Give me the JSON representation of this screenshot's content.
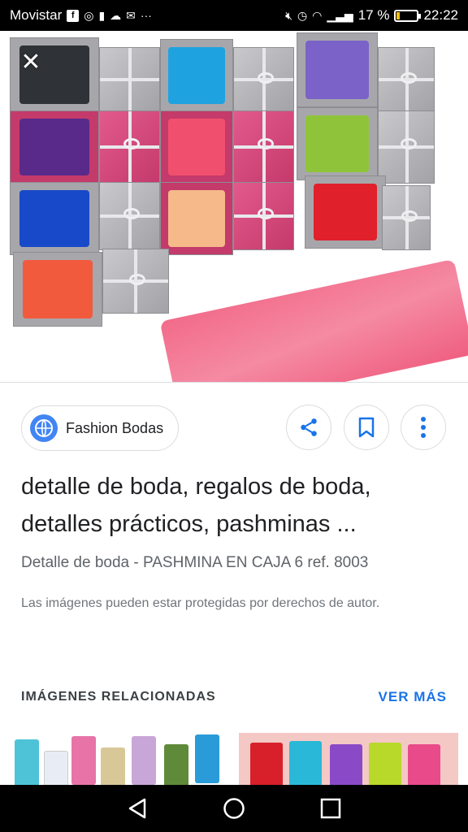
{
  "status": {
    "carrier": "Movistar",
    "battery_percent": "17 %",
    "time": "22:22",
    "battery_level": 0.17
  },
  "hero": {
    "close_icon": "close-icon"
  },
  "source": {
    "site_name": "Fashion Bodas",
    "icons": [
      "globe-icon",
      "share-icon",
      "bookmark-icon",
      "more-vert-icon"
    ]
  },
  "result": {
    "title": "detalle de boda, regalos de boda, detalles prácticos, pashminas ...",
    "subtitle": "Detalle de boda - PASHMINA EN CAJA 6 ref. 8003",
    "notice": "Las imágenes pueden estar protegidas por derechos de autor."
  },
  "related": {
    "title": "IMÁGENES RELACIONADAS",
    "more_label": "VER MÁS"
  },
  "colors": {
    "accent": "#1a73e8",
    "scarves": [
      "#2f3236",
      "#1fa3e0",
      "#7b62c8",
      "#5a2a8a",
      "#f0506e",
      "#8fc43a",
      "#1849c8",
      "#f5b98a",
      "#e0202a",
      "#f25a3e",
      "#f26b8a"
    ]
  }
}
